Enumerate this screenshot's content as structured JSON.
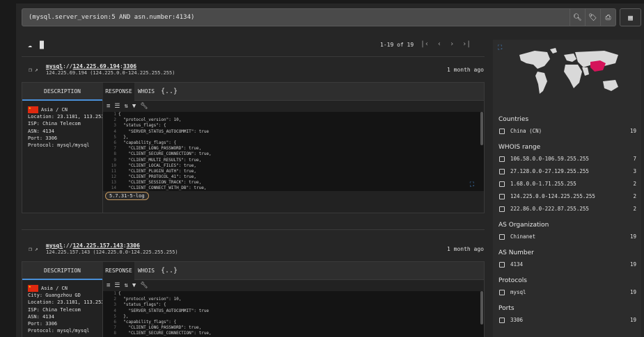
{
  "search": {
    "query": "(mysql.server_version:5 AND asn.number:4134)",
    "icons": [
      "search-icon",
      "tag-icon",
      "report-icon"
    ]
  },
  "toolbar": {
    "icons": [
      "download-icon",
      "chart-icon"
    ],
    "pager": "1-19 of 19"
  },
  "results": [
    {
      "scheme": "mysql",
      "sep": "://",
      "ip": "124.225.69.194",
      "port": "3306",
      "subline": "124.225.69.194 (124.225.0.0-124.225.255.255)",
      "age": "1 month ago",
      "tabs": {
        "description": "DESCRIPTION",
        "response": "RESPONSE",
        "whois": "WHOIS",
        "json": "{..}"
      },
      "region": "Asia / CN",
      "details": [
        "Location: 23.1181, 113.2539",
        "ISP: China Telecom",
        "ASN: 4134",
        "Port: 3306",
        "Protocol: mysql/mysql"
      ],
      "version": "5.7.31-5-log",
      "code": [
        {
          "n": "1",
          "t": "{"
        },
        {
          "n": "2",
          "t": "  \"protocol_version\": 10,"
        },
        {
          "n": "3",
          "t": "  \"status_flags\": {"
        },
        {
          "n": "4",
          "t": "    \"SERVER_STATUS_AUTOCOMMIT\": true"
        },
        {
          "n": "5",
          "t": "  },"
        },
        {
          "n": "6",
          "t": "  \"capability_flags\": {"
        },
        {
          "n": "7",
          "t": "    \"CLIENT_LONG_PASSWORD\": true,"
        },
        {
          "n": "8",
          "t": "    \"CLIENT_SECURE_CONNECTION\": true,"
        },
        {
          "n": "9",
          "t": "    \"CLIENT_MULTI_RESULTS\": true,"
        },
        {
          "n": "10",
          "t": "    \"CLIENT_LOCAL_FILES\": true,"
        },
        {
          "n": "11",
          "t": "    \"CLIENT_PLUGIN_AUTH\": true,"
        },
        {
          "n": "12",
          "t": "    \"CLIENT_PROTOCOL_41\": true,"
        },
        {
          "n": "13",
          "t": "    \"CLIENT_SESSION_TRACK\": true,"
        },
        {
          "n": "14",
          "t": "    \"CLIENT_CONNECT_WITH_DB\": true,"
        },
        {
          "n": "15",
          "t": "    \"CLIENT_TRANSACTIONS\": true,"
        }
      ]
    },
    {
      "scheme": "mysql",
      "sep": "://",
      "ip": "124.225.157.143",
      "port": "3306",
      "subline": "124.225.157.143 (124.225.0.0-124.225.255.255)",
      "age": "1 month ago",
      "tabs": {
        "description": "DESCRIPTION",
        "response": "RESPONSE",
        "whois": "WHOIS",
        "json": "{..}"
      },
      "region": "Asia / CN",
      "details": [
        "City: Guangzhou GD",
        "Location: 23.1181, 113.2539",
        "ISP: China Telecom",
        "ASN: 4134",
        "Port: 3306",
        "Protocol: mysql/mysql"
      ],
      "code": [
        {
          "n": "1",
          "t": "{"
        },
        {
          "n": "2",
          "t": "  \"protocol_version\": 10,"
        },
        {
          "n": "3",
          "t": "  \"status_flags\": {"
        },
        {
          "n": "4",
          "t": "    \"SERVER_STATUS_AUTOCOMMIT\": true"
        },
        {
          "n": "5",
          "t": "  },"
        },
        {
          "n": "6",
          "t": "  \"capability_flags\": {"
        },
        {
          "n": "7",
          "t": "    \"CLIENT_LONG_PASSWORD\": true,"
        },
        {
          "n": "8",
          "t": "    \"CLIENT_SECURE_CONNECTION\": true,"
        }
      ]
    }
  ],
  "sidebar": {
    "facets": [
      {
        "title": "Countries",
        "items": [
          {
            "label": "China (CN)",
            "count": "19"
          }
        ]
      },
      {
        "title": "WHOIS range",
        "items": [
          {
            "label": "106.58.0.0-106.59.255.255",
            "count": "7"
          },
          {
            "label": "27.128.0.0-27.129.255.255",
            "count": "3"
          },
          {
            "label": "1.68.0.0-1.71.255.255",
            "count": "2"
          },
          {
            "label": "124.225.0.0-124.225.255.255",
            "count": "2"
          },
          {
            "label": "222.86.0.0-222.87.255.255",
            "count": "2"
          }
        ]
      },
      {
        "title": "AS Organization",
        "items": [
          {
            "label": "Chinanet",
            "count": "19"
          }
        ]
      },
      {
        "title": "AS Number",
        "items": [
          {
            "label": "4134",
            "count": "19"
          }
        ]
      },
      {
        "title": "Protocols",
        "items": [
          {
            "label": "mysql",
            "count": "19"
          }
        ]
      },
      {
        "title": "Ports",
        "items": [
          {
            "label": "3306",
            "count": "19"
          }
        ]
      }
    ]
  },
  "colors": {
    "accent": "#4a90d9",
    "highlight_country": "#d4145a"
  }
}
